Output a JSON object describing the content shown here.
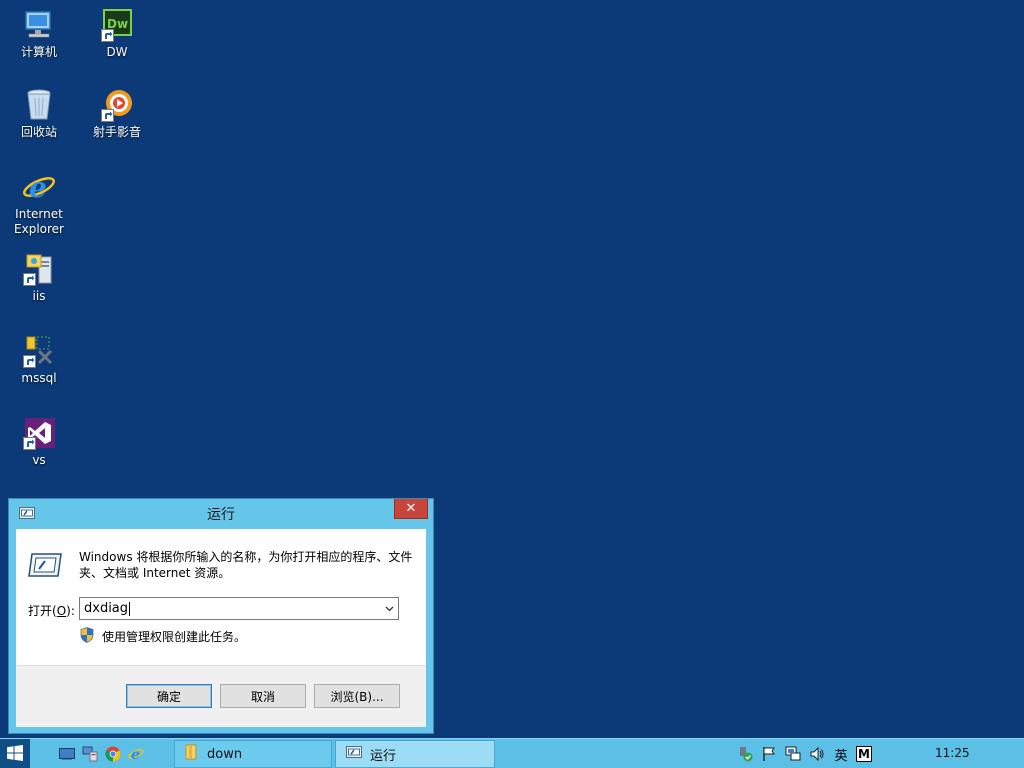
{
  "desktop": {
    "icons": [
      {
        "label": "计算机"
      },
      {
        "label": "DW"
      },
      {
        "label": "回收站"
      },
      {
        "label": "射手影音"
      },
      {
        "label": "Internet\nExplorer"
      },
      {
        "label": "iis"
      },
      {
        "label": "mssql"
      },
      {
        "label": "vs"
      }
    ]
  },
  "run_dialog": {
    "title": "运行",
    "close_label": "✕",
    "description": "Windows 将根据你所输入的名称，为你打开相应的程序、文件夹、文档或 Internet 资源。",
    "open_label_prefix": "打开(",
    "open_label_key": "O",
    "open_label_suffix": "):",
    "input_value": "dxdiag",
    "admin_note": "使用管理权限创建此任务。",
    "buttons": {
      "ok": "确定",
      "cancel": "取消",
      "browse": "浏览(B)..."
    }
  },
  "taskbar": {
    "tasks": [
      {
        "label": "down"
      },
      {
        "label": "运行"
      }
    ],
    "ime_lang": "英",
    "ime_mode": "M",
    "clock": "11:25"
  },
  "colors": {
    "desktop": "#0c3a78",
    "dialog_frame": "#66c6ea",
    "taskbar": "#5bbfe6",
    "close_button": "#c7463c"
  }
}
